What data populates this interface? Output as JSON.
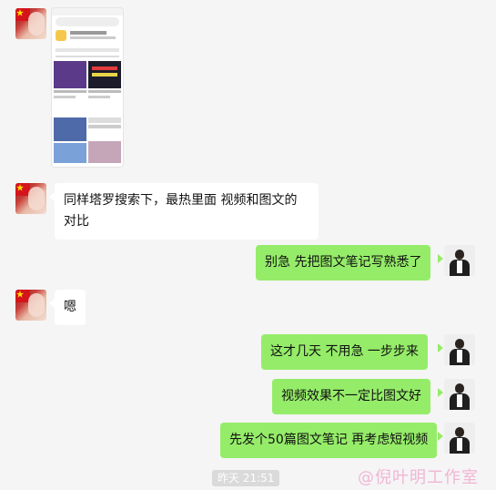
{
  "messages": [
    {
      "side": "left",
      "type": "image",
      "content": "screenshot-thumbnail"
    },
    {
      "side": "left",
      "text": "同样塔罗搜索下，最热里面 视频和图文的对比"
    },
    {
      "side": "right",
      "text": "别急  先把图文笔记写熟悉了"
    },
    {
      "side": "left",
      "text": "嗯"
    },
    {
      "side": "right",
      "text": "这才几天 不用急  一步步来"
    },
    {
      "side": "right",
      "text": "视频效果不一定比图文好"
    },
    {
      "side": "right",
      "text": "先发个50篇图文笔记 再考虑短视频"
    }
  ],
  "timestamp": "昨天 21:51",
  "watermark": "@倪叶明工作室",
  "thumbnail": {
    "tabs": [
      "全部",
      "用户",
      "商品"
    ],
    "cards": [
      "TA终于主动了",
      "TA接下来会怎样"
    ]
  },
  "colors": {
    "right_bubble": "#95ec69",
    "left_bubble": "#ffffff",
    "background": "#f5f5f5",
    "watermark": "#f1b6d4"
  }
}
